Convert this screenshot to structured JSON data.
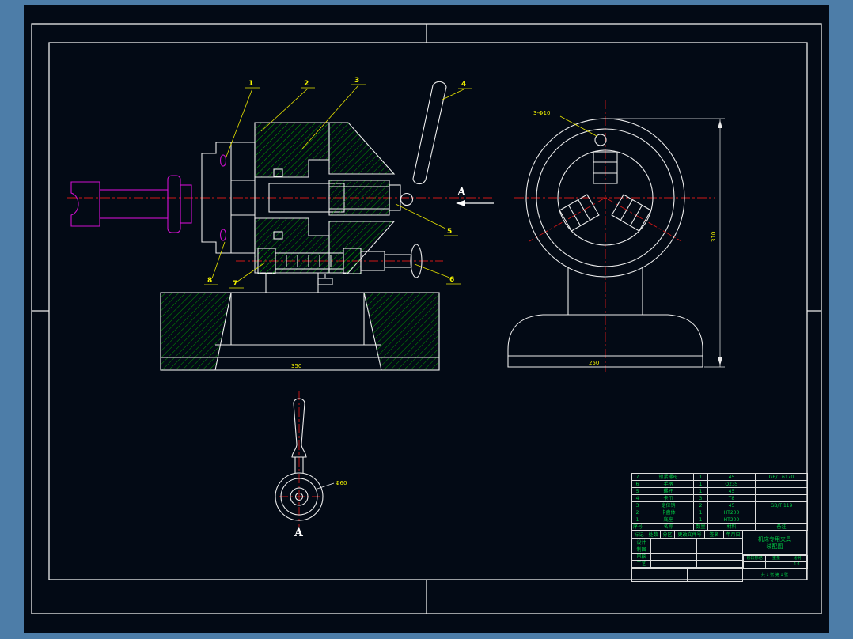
{
  "canvas": {
    "bg_outer": "#4d7da8",
    "bg_inner": "#030a15",
    "frame_color": "#ededed",
    "hatch_color": "#00a000",
    "centerline_color": "#d01818",
    "callout_color": "#f5f500",
    "workpiece_color": "#cf10cf",
    "titleblock_text_color": "#00cc44"
  },
  "labels": {
    "section_a": "A",
    "view_a": "A"
  },
  "callouts": [
    "1",
    "2",
    "3",
    "4",
    "5",
    "6",
    "7",
    "8"
  ],
  "dims": {
    "front_holes": "3-Φ10",
    "front_height": "310",
    "front_width": "250",
    "base_width": "350",
    "handle_dia": "Φ60"
  },
  "title_block": {
    "parts": [
      {
        "seq": "7",
        "name": "锁紧螺母",
        "qty": "1",
        "material": "45",
        "note": "GB/T 6170"
      },
      {
        "seq": "6",
        "name": "手柄",
        "qty": "1",
        "material": "Q235",
        "note": ""
      },
      {
        "seq": "5",
        "name": "螺杆",
        "qty": "1",
        "material": "45",
        "note": ""
      },
      {
        "seq": "4",
        "name": "卡爪",
        "qty": "3",
        "material": "T8",
        "note": ""
      },
      {
        "seq": "3",
        "name": "定位销",
        "qty": "2",
        "material": "45",
        "note": "GB/T 119"
      },
      {
        "seq": "2",
        "name": "卡盘体",
        "qty": "1",
        "material": "HT200",
        "note": ""
      },
      {
        "seq": "1",
        "name": "底座",
        "qty": "1",
        "material": "HT200",
        "note": ""
      },
      {
        "seq": "序号",
        "name": "名称",
        "qty": "数量",
        "material": "材料",
        "note": "备注"
      }
    ],
    "meta": [
      "标记",
      "处数",
      "分区",
      "更改文件号",
      "签名",
      "年月日"
    ],
    "roles": [
      {
        "label": "设计",
        "name": "",
        "date": ""
      },
      {
        "label": "制图",
        "name": "",
        "date": ""
      },
      {
        "label": "审核",
        "name": "",
        "date": ""
      },
      {
        "label": "工艺",
        "name": "",
        "date": ""
      }
    ],
    "title_line1": "机床专用夹具",
    "title_line2": "装配图",
    "info_labels": [
      "阶段标记",
      "重量",
      "比例"
    ],
    "info_values": [
      "",
      "",
      "1:1"
    ],
    "sheet": "共 1 张  第 1 张"
  }
}
